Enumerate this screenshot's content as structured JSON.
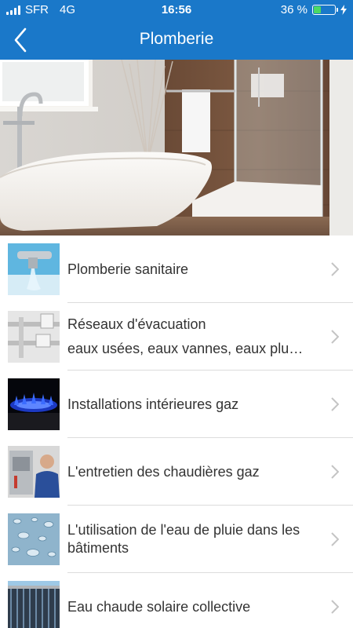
{
  "status": {
    "carrier": "SFR",
    "network": "4G",
    "time": "16:56",
    "battery": "36 %",
    "battery_level": 0.36
  },
  "nav": {
    "title": "Plomberie",
    "back_icon": "chevron-left-icon"
  },
  "items": [
    {
      "label": "Plomberie sanitaire",
      "sub": "",
      "icon": "faucet-photo"
    },
    {
      "label": "Réseaux d'évacuation",
      "sub": "eaux usées, eaux vannes, eaux plu…",
      "icon": "pipes-photo"
    },
    {
      "label": "Installations intérieures gaz",
      "sub": "",
      "icon": "gas-flame-photo"
    },
    {
      "label": "L'entretien des chaudières gaz",
      "sub": "",
      "icon": "boiler-technician-photo"
    },
    {
      "label": "L'utilisation de l'eau de pluie dans les bâtiments",
      "sub": "",
      "icon": "water-drops-photo"
    },
    {
      "label": "Eau chaude solaire collective",
      "sub": "",
      "icon": "solar-panel-photo"
    }
  ],
  "colors": {
    "accent": "#1a78c9",
    "text": "#333333",
    "separator": "#dcdcdc",
    "battery_fill": "#4cd964"
  }
}
